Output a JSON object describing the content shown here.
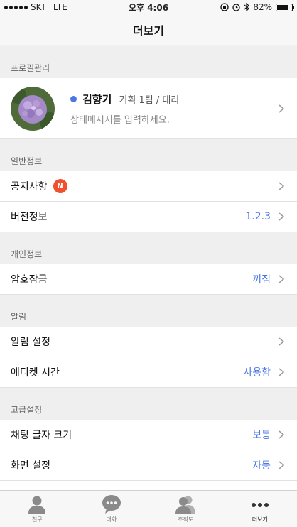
{
  "status_bar": {
    "carrier": "SKT",
    "network": "LTE",
    "time": "오후 4:06",
    "battery_percent": "82%",
    "battery_level": 0.82
  },
  "nav": {
    "title": "더보기"
  },
  "profile_section": {
    "header": "프로필관리"
  },
  "profile": {
    "name": "김향기",
    "department": "기획 1팀 / 대리",
    "status_message": "상태메시지를 입력하세요."
  },
  "general_section": {
    "header": "일반정보",
    "notice_label": "공지사항",
    "notice_badge": "N",
    "version_label": "버전정보",
    "version_value": "1.2.3"
  },
  "personal_section": {
    "header": "개인정보",
    "lock_label": "암호잠금",
    "lock_value": "꺼짐"
  },
  "alert_section": {
    "header": "알림",
    "alert_settings_label": "알림 설정",
    "etiquette_label": "에티켓 시간",
    "etiquette_value": "사용함"
  },
  "advanced_section": {
    "header": "고급설정",
    "font_size_label": "채팅 글자 크기",
    "font_size_value": "보통",
    "screen_label": "화면 설정",
    "screen_value": "자동"
  },
  "tabs": [
    {
      "label": "친구",
      "icon": "person-icon"
    },
    {
      "label": "대화",
      "icon": "chat-bubble-icon"
    },
    {
      "label": "조직도",
      "icon": "org-chart-icon"
    },
    {
      "label": "더보기",
      "icon": "more-dots-icon"
    }
  ],
  "colors": {
    "accent": "#4a76e8",
    "badge": "#f0502d"
  }
}
